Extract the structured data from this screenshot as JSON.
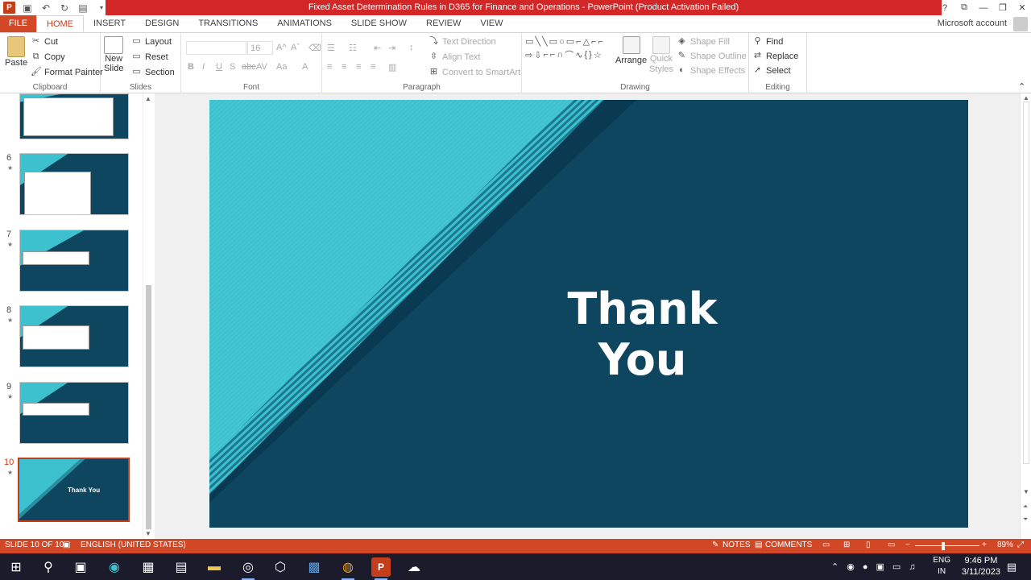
{
  "window": {
    "title": "Fixed Asset Determination Rules in D365 for Finance and Operations  -  PowerPoint (Product Activation Failed)",
    "controls": [
      "?",
      "⧉",
      "—",
      "❐",
      "✕"
    ]
  },
  "tabs": {
    "file": "FILE",
    "items": [
      "HOME",
      "INSERT",
      "DESIGN",
      "TRANSITIONS",
      "ANIMATIONS",
      "SLIDE SHOW",
      "REVIEW",
      "VIEW"
    ],
    "active": "HOME",
    "account": "Microsoft account"
  },
  "ribbon": {
    "clipboard": {
      "label": "Clipboard",
      "paste": "Paste",
      "cut": "Cut",
      "copy": "Copy",
      "format_painter": "Format Painter"
    },
    "slides": {
      "label": "Slides",
      "new_slide_1": "New",
      "new_slide_2": "Slide",
      "layout": "Layout",
      "reset": "Reset",
      "section": "Section"
    },
    "font": {
      "label": "Font",
      "size": "16"
    },
    "paragraph": {
      "label": "Paragraph",
      "text_direction": "Text Direction",
      "align_text": "Align Text",
      "convert_smartart": "Convert to SmartArt"
    },
    "drawing": {
      "label": "Drawing",
      "arrange": "Arrange",
      "quick_styles_1": "Quick",
      "quick_styles_2": "Styles",
      "shape_fill": "Shape Fill",
      "shape_outline": "Shape Outline",
      "shape_effects": "Shape Effects"
    },
    "editing": {
      "label": "Editing",
      "find": "Find",
      "replace": "Replace",
      "select": "Select"
    }
  },
  "slides_panel": {
    "thumbs": [
      {
        "num": "",
        "starred": false
      },
      {
        "num": "6",
        "starred": true
      },
      {
        "num": "7",
        "starred": true
      },
      {
        "num": "8",
        "starred": true
      },
      {
        "num": "9",
        "starred": true
      },
      {
        "num": "10",
        "starred": true,
        "title": "Thank You",
        "selected": true
      }
    ]
  },
  "slide": {
    "title": "Thank You"
  },
  "statusbar": {
    "slide_info": "SLIDE 10 OF 10",
    "language": "ENGLISH (UNITED STATES)",
    "notes": "NOTES",
    "comments": "COMMENTS",
    "zoom": "89%"
  },
  "taskbar": {
    "lang_1": "ENG",
    "lang_2": "IN",
    "time": "9:46 PM",
    "date": "3/11/2023"
  },
  "colors": {
    "accent": "#d24726",
    "title_bar_warning": "#d32626",
    "slide_dark": "#0e4660",
    "slide_light": "#3ec1cf"
  }
}
